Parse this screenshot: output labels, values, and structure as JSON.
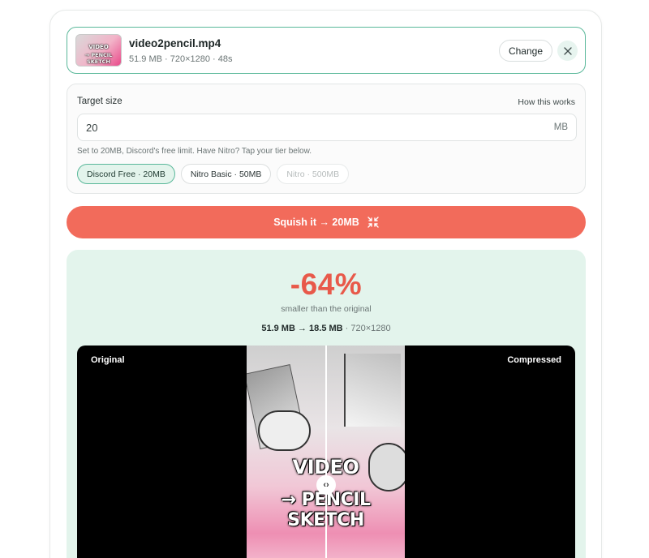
{
  "file": {
    "name": "video2pencil.mp4",
    "meta": "51.9 MB · 720×1280 · 48s",
    "thumb_line1": "VIDEO",
    "thumb_line2": "→ PENCIL SKETCH",
    "change_label": "Change",
    "close_icon": "close-icon"
  },
  "target": {
    "label": "Target size",
    "how_link": "How this works",
    "value": "20",
    "unit": "MB",
    "hint": "Set to 20MB, Discord's free limit. Have Nitro? Tap your tier below.",
    "tiers": [
      {
        "label": "Discord Free · 20MB",
        "state": "active"
      },
      {
        "label": "Nitro Basic · 50MB",
        "state": "normal"
      },
      {
        "label": "Nitro · 500MB",
        "state": "disabled"
      }
    ]
  },
  "action": {
    "label": "Squish it → 20MB",
    "icon": "compress-arrows-icon",
    "color": "#f26b5b"
  },
  "result": {
    "percent": "-64%",
    "subtitle": "smaller than the original",
    "sizes": "51.9 MB → 18.5 MB",
    "dimensions": "· 720×1280",
    "accent": "#e8594a",
    "compare": {
      "left_label": "Original",
      "right_label": "Compressed",
      "video_line1": "VIDEO",
      "video_line2": "→ PENCIL SKETCH",
      "handle_icon": "drag-handle-icon",
      "handle_glyph": "‹›"
    }
  },
  "colors": {
    "accent_green": "#5ab89a",
    "panel_green": "#e3f4ec"
  }
}
